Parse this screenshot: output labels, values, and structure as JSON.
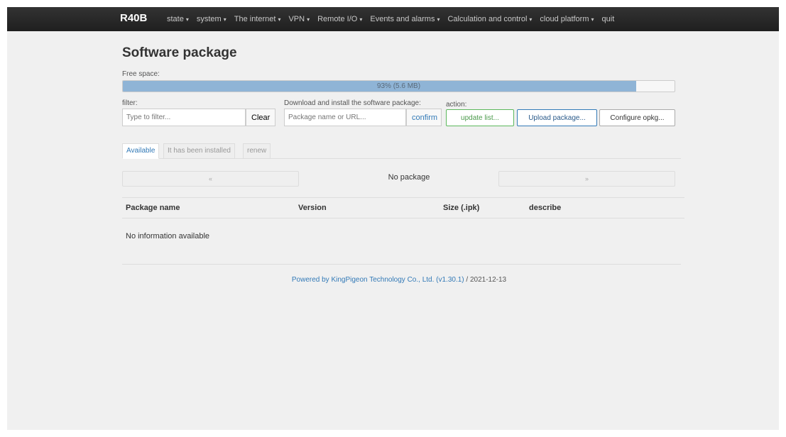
{
  "navbar": {
    "brand": "R40B",
    "menu": [
      {
        "label": "state",
        "dropdown": true
      },
      {
        "label": "system",
        "dropdown": true
      },
      {
        "label": "The internet",
        "dropdown": true
      },
      {
        "label": "VPN",
        "dropdown": true
      },
      {
        "label": "Remote I/O",
        "dropdown": true
      },
      {
        "label": "Events and alarms",
        "dropdown": true
      },
      {
        "label": "Calculation and control",
        "dropdown": true
      },
      {
        "label": "cloud platform",
        "dropdown": true
      },
      {
        "label": "quit",
        "dropdown": false
      }
    ]
  },
  "page": {
    "title": "Software package",
    "free_space_label": "Free space:",
    "free_space_percent": 93,
    "free_space_text": "93% (5.6 MB)"
  },
  "controls": {
    "filter_label": "filter:",
    "filter_placeholder": "Type to filter...",
    "clear_label": "Clear",
    "download_label": "Download and install the software package:",
    "download_placeholder": "Package name or URL...",
    "confirm_label": "confirm",
    "action_label": "action:",
    "update_list_label": "update list...",
    "upload_label": "Upload package...",
    "configure_label": "Configure opkg..."
  },
  "tabs": {
    "available": "Available",
    "installed": "It has been installed",
    "renew": "renew"
  },
  "pager": {
    "prev": "«",
    "next": "»",
    "info": "No package"
  },
  "table": {
    "col_name": "Package name",
    "col_version": "Version",
    "col_size": "Size (.ipk)",
    "col_describe": "describe",
    "empty_text": "No information available"
  },
  "footer": {
    "link_text": "Powered by KingPigeon Technology Co., Ltd. (v1.30.1)",
    "date_text": " / 2021-12-13"
  },
  "colors": {
    "navbar": "#222222",
    "progress_fill": "#8fb4d6",
    "link": "#337ab7"
  }
}
